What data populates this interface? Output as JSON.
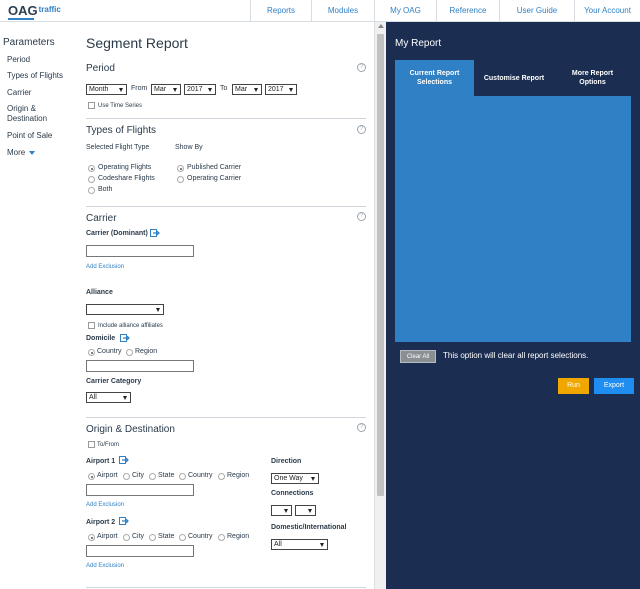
{
  "logo": {
    "main": "OAG",
    "sub": "traffic"
  },
  "nav": [
    "Reports",
    "Modules",
    "My OAG",
    "Reference",
    "User Guide",
    "Your Account"
  ],
  "sidebar": {
    "title": "Parameters",
    "items": [
      "Period",
      "Types of Flights",
      "Carrier",
      "Origin & Destination",
      "Point of Sale",
      "More"
    ]
  },
  "page_title": "Segment Report",
  "help_symbol": "?",
  "period": {
    "title": "Period",
    "granularity": "Month",
    "from_label": "From",
    "from_month": "Mar",
    "from_year": "2017",
    "to_label": "To",
    "to_month": "Mar",
    "to_year": "2017",
    "time_series": "Use Time Series"
  },
  "flights": {
    "title": "Types of Flights",
    "selected_label": "Selected Flight Type",
    "show_by_label": "Show By",
    "types": [
      "Operating Flights",
      "Codeshare Flights",
      "Both"
    ],
    "show_by": [
      "Published Carrier",
      "Operating Carrier"
    ]
  },
  "carrier": {
    "title": "Carrier",
    "dominant_label": "Carrier (Dominant)",
    "add_exclusion": "Add Exclusion",
    "alliance_label": "Alliance",
    "alliance_affiliates": "Include alliance affiliates",
    "domicile_label": "Domicile",
    "domicile_options": [
      "Country",
      "Region"
    ],
    "category_label": "Carrier Category",
    "category_value": "All"
  },
  "od": {
    "title": "Origin & Destination",
    "to_from": "To/From",
    "airport1_label": "Airport 1",
    "airport2_label": "Airport 2",
    "loc_options": [
      "Airport",
      "City",
      "State",
      "Country",
      "Region"
    ],
    "add_exclusion": "Add Exclusion",
    "direction_label": "Direction",
    "direction_value": "One Way",
    "connections_label": "Connections",
    "domestic_label": "Domestic/International",
    "domestic_value": "All"
  },
  "panel": {
    "title": "My Report",
    "tabs": [
      "Current Report Selections",
      "Customise Report",
      "More Report Options"
    ],
    "clear_label": "Clear All",
    "clear_message": "This option will clear all report selections.",
    "run_label": "Run",
    "export_label": "Export"
  },
  "colors": {
    "accent": "#2f80c4",
    "panel_bg": "#1b2d50",
    "run": "#f0a800",
    "export": "#1f8ef0"
  }
}
